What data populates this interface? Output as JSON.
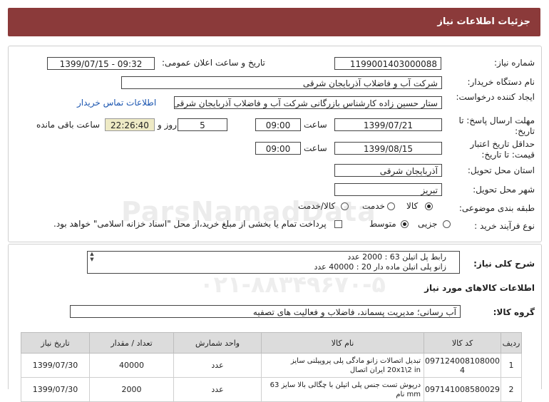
{
  "header": {
    "title": "جزئیات اطلاعات نیاز"
  },
  "fields": {
    "need_number_label": "شماره نیاز:",
    "need_number": "1199001403000088",
    "announce_label": "تاریخ و ساعت اعلان عمومی:",
    "announce_value": "1399/07/15 - 09:32",
    "buyer_label": "نام دستگاه خریدار:",
    "buyer_value": "شرکت آب و فاضلاب آذربایجان شرقی",
    "creator_label": "ایجاد کننده درخواست:",
    "creator_value": "ستار حسین زاده کارشناس بازرگانی شرکت آب و فاضلاب آذربایجان شرقی",
    "contact_link": "اطلاعات تماس خریدار",
    "reply_deadline_label": "مهلت ارسال پاسخ: تا تاریخ:",
    "reply_date": "1399/07/21",
    "time_label": "ساعت",
    "reply_time": "09:00",
    "days_value": "5",
    "days_label": "روز و",
    "remaining_time": "22:26:40",
    "remaining_label": "ساعت باقی مانده",
    "validity_label": "حداقل تاریخ اعتبار قیمت: تا تاریخ:",
    "validity_date": "1399/08/15",
    "validity_time": "09:00",
    "province_label": "استان محل تحویل:",
    "province_value": "آذربایجان شرقی",
    "city_label": "شهر محل تحویل:",
    "city_value": "تبریز",
    "category_label": "طبقه بندی موضوعی:",
    "category_options": [
      "کالا",
      "خدمت",
      "کالا/خدمت"
    ],
    "purchase_type_label": "نوع فرآیند خرید :",
    "purchase_options": [
      "جزیی",
      "متوسط"
    ],
    "payment_note": "پرداخت تمام یا بخشی از مبلغ خرید،از محل \"اسناد خزانه اسلامی\" خواهد بود."
  },
  "description": {
    "label": "شرح کلی نیاز:",
    "lines": [
      "رابط پل اتیلن 63 : 2000 عدد",
      "زانو پلی اتیلن ماده دار 20 : 40000 عدد"
    ]
  },
  "goods_section": {
    "title": "اطلاعات کالاهای مورد نیاز",
    "group_label": "گروه کالا:",
    "group_value": "آب رسانی؛ مدیریت پسماند، فاضلاب و فعالیت های تصفیه"
  },
  "table": {
    "headers": [
      "ردیف",
      "کد کالا",
      "نام کالا",
      "واحد شمارش",
      "تعداد / مقدار",
      "تاریخ نیاز"
    ],
    "rows": [
      {
        "index": "1",
        "code": "097124008108000 4",
        "name": "تبدیل اتصالات زانو مادگی پلی پروپیلنی سایز 20x1\\2 in ایران اتصال",
        "unit": "عدد",
        "qty": "40000",
        "date": "1399/07/30"
      },
      {
        "index": "2",
        "code": "097141008580029",
        "name": "درپوش تست جنس پلی اتیلن با چگالی بالا سایز 63 mm نام",
        "unit": "عدد",
        "qty": "2000",
        "date": "1399/07/30"
      }
    ]
  },
  "watermark": {
    "line1": "ParsNamadData",
    "line2": "۰۲۱-۸۸۳۴۹۶۷۰-۵"
  }
}
